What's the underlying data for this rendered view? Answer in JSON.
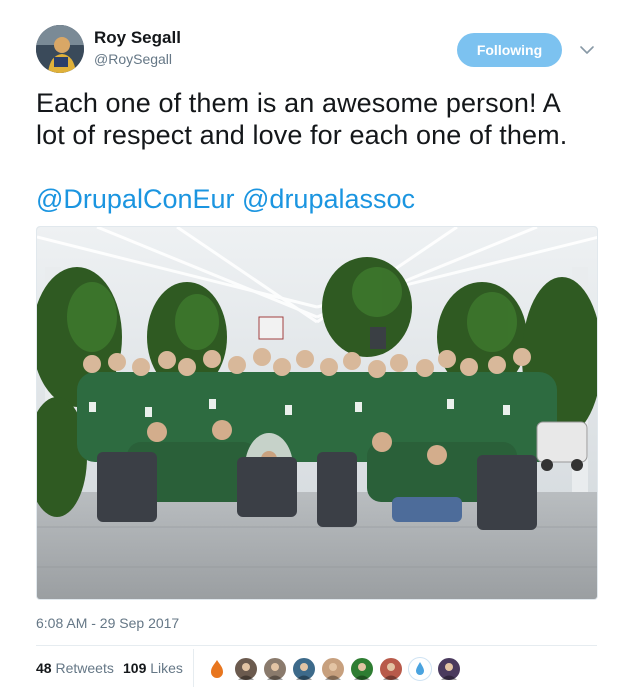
{
  "author": {
    "name": "Roy Segall",
    "handle": "@RoySegall"
  },
  "follow_button": {
    "label": "Following",
    "color": "#7cc2f0"
  },
  "tweet": {
    "line1": "Each one of them is an awesome person! A",
    "line2": "lot of respect and love for each one of them.",
    "mentions": [
      "@DrupalConEur",
      "@drupalassoc"
    ]
  },
  "timestamp": "6:08 AM - 29 Sep 2017",
  "stats": {
    "retweets_count": "48",
    "retweets_label": "Retweets",
    "likes_count": "109",
    "likes_label": "Likes"
  },
  "likers": [
    {
      "icon": "drupal-drop-avatar",
      "color": "#e8761f"
    },
    {
      "icon": "person-avatar",
      "color": "#6b5a4e"
    },
    {
      "icon": "person-avatar",
      "color": "#8a7a6c"
    },
    {
      "icon": "person-avatar",
      "color": "#3d6a8a"
    },
    {
      "icon": "person-avatar",
      "color": "#c7a07e"
    },
    {
      "icon": "person-avatar",
      "color": "#2e7d32"
    },
    {
      "icon": "person-avatar",
      "color": "#b85a4a"
    },
    {
      "icon": "water-drop-avatar",
      "color": "#4aa3df"
    },
    {
      "icon": "person-avatar",
      "color": "#4a3a5e"
    }
  ],
  "colors": {
    "link": "#1b95e0",
    "muted": "#657786",
    "text": "#14171a"
  }
}
